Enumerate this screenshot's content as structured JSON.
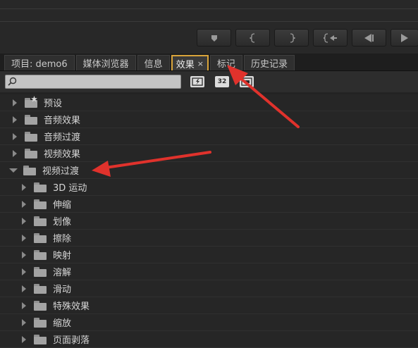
{
  "tabs": [
    {
      "label": "项目: demo6",
      "active": false
    },
    {
      "label": "媒体浏览器",
      "active": false
    },
    {
      "label": "信息",
      "active": false
    },
    {
      "label": "效果",
      "active": true,
      "close": "×"
    },
    {
      "label": "标记",
      "active": false
    },
    {
      "label": "历史记录",
      "active": false
    }
  ],
  "search": {
    "value": "",
    "placeholder": ""
  },
  "toolbar": {
    "accelerated_label": "",
    "bit32_label": "32",
    "yuv_label": ""
  },
  "transport_icons": [
    "marker-icon",
    "in-point-icon",
    "out-point-icon",
    "go-to-in-icon",
    "step-back-icon",
    "play-icon"
  ],
  "tree": {
    "top_level": [
      {
        "label": "预设",
        "expanded": false,
        "icon": "preset-folder-icon"
      },
      {
        "label": "音频效果",
        "expanded": false,
        "icon": "folder-icon"
      },
      {
        "label": "音频过渡",
        "expanded": false,
        "icon": "folder-icon"
      },
      {
        "label": "视频效果",
        "expanded": false,
        "icon": "folder-icon"
      },
      {
        "label": "视频过渡",
        "expanded": true,
        "icon": "folder-icon"
      }
    ],
    "children": [
      {
        "label": "3D 运动"
      },
      {
        "label": "伸缩"
      },
      {
        "label": "划像"
      },
      {
        "label": "擦除"
      },
      {
        "label": "映射"
      },
      {
        "label": "溶解"
      },
      {
        "label": "滑动"
      },
      {
        "label": "特殊效果"
      },
      {
        "label": "缩放"
      },
      {
        "label": "页面剥落"
      }
    ]
  },
  "colors": {
    "active_tab_border": "#d9a43a",
    "annotation_arrow": "#e0322c",
    "panel_bg": "#262626"
  }
}
